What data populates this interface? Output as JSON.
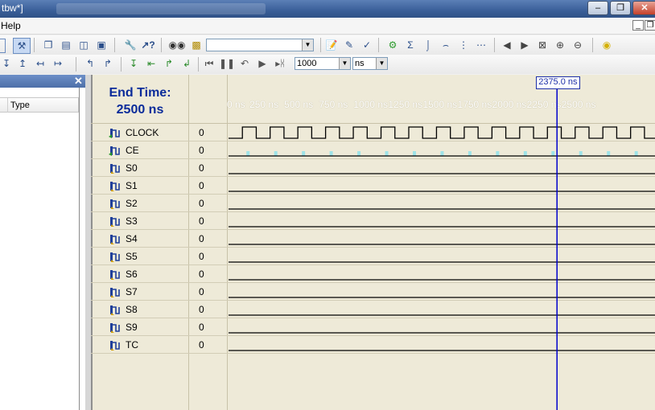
{
  "window": {
    "title_fragment": "tbw*]"
  },
  "menu": {
    "help": "Help"
  },
  "toolbar": {
    "count_value": "1000",
    "unit_value": "ns",
    "search_value": "",
    "icons": [
      "zoom-glasses-icon",
      "auto-icon",
      "cascade-icon",
      "tile-h-icon",
      "tile-v-icon",
      "window-icon",
      "wrench-icon",
      "whats-this-icon",
      "binoculars-icon",
      "find-icon",
      "apply-icon",
      "edit-icon",
      "check-icon",
      "gear-icon",
      "sigma-icon",
      "wave-add-icon",
      "wave-delete-icon",
      "wave-split-icon",
      "back-circle-icon",
      "forward-circle-icon",
      "stop-icon",
      "zoom-in-icon",
      "zoom-out-icon",
      "bulb-icon"
    ]
  },
  "left_panel": {
    "column_type": "Type"
  },
  "waveform": {
    "end_time_label": "End Time:",
    "end_time_value": "2500 ns",
    "cursor_label": "2375.0 ns",
    "cursor_time": 2375,
    "axis_max": 2500,
    "ticks": [
      "0 ns",
      "250 ns",
      "500 ns",
      "750 ns",
      "1000 ns",
      "1250 ns",
      "1500 ns",
      "1750 ns",
      "2000 ns",
      "2250 ns",
      "2500 ns"
    ],
    "signals": [
      {
        "name": "CLOCK",
        "value": "0",
        "kind": "input",
        "wave": "clock"
      },
      {
        "name": "CE",
        "value": "0",
        "kind": "input",
        "wave": "low"
      },
      {
        "name": "S0",
        "value": "0",
        "kind": "output",
        "wave": "low"
      },
      {
        "name": "S1",
        "value": "0",
        "kind": "output",
        "wave": "low"
      },
      {
        "name": "S2",
        "value": "0",
        "kind": "output",
        "wave": "low"
      },
      {
        "name": "S3",
        "value": "0",
        "kind": "output",
        "wave": "low"
      },
      {
        "name": "S4",
        "value": "0",
        "kind": "output",
        "wave": "low"
      },
      {
        "name": "S5",
        "value": "0",
        "kind": "output",
        "wave": "low"
      },
      {
        "name": "S6",
        "value": "0",
        "kind": "output",
        "wave": "low"
      },
      {
        "name": "S7",
        "value": "0",
        "kind": "output",
        "wave": "low"
      },
      {
        "name": "S8",
        "value": "0",
        "kind": "output",
        "wave": "low"
      },
      {
        "name": "S9",
        "value": "0",
        "kind": "output",
        "wave": "low"
      },
      {
        "name": "TC",
        "value": "0",
        "kind": "output",
        "wave": "low"
      }
    ],
    "clock_period_ns": 200,
    "colors": {
      "background": "#eeead8",
      "cursor": "#0000cc",
      "trace": "#000000",
      "ce_marker": "#9fe3e8"
    }
  }
}
